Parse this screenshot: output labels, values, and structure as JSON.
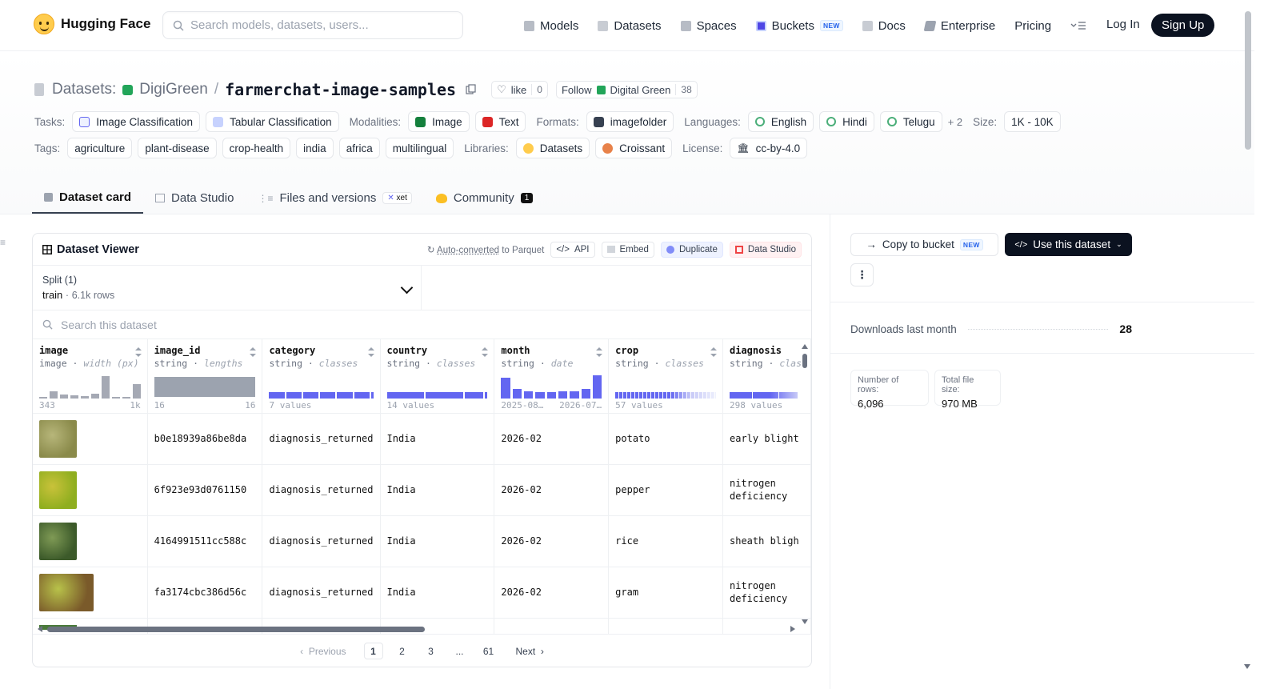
{
  "header": {
    "brand": "Hugging Face",
    "search_placeholder": "Search models, datasets, users...",
    "nav": [
      {
        "label": "Models",
        "icon": "cube-icon",
        "color": "#9ca3af"
      },
      {
        "label": "Datasets",
        "icon": "database-icon",
        "color": "#9ca3af"
      },
      {
        "label": "Spaces",
        "icon": "grid-icon",
        "color": "#9ca3af"
      },
      {
        "label": "Buckets",
        "icon": "bucket-icon",
        "color": "#4f46e5",
        "badge": "NEW"
      },
      {
        "label": "Docs",
        "icon": "book-icon",
        "color": "#9ca3af"
      },
      {
        "label": "Enterprise",
        "icon": "building-icon",
        "color": "#9ca3af"
      },
      {
        "label": "Pricing"
      }
    ],
    "login": "Log In",
    "signup": "Sign Up"
  },
  "repo": {
    "prefix": "Datasets:",
    "org": "DigiGreen",
    "name": "farmerchat-image-samples",
    "like_label": "like",
    "like_count": "0",
    "follow_label": "Follow",
    "follow_org": "Digital Green",
    "follow_count": "38"
  },
  "tags_row1": {
    "tasks_label": "Tasks:",
    "tasks": [
      "Image Classification",
      "Tabular Classification"
    ],
    "modalities_label": "Modalities:",
    "modalities": [
      "Image",
      "Text"
    ],
    "formats_label": "Formats:",
    "formats": [
      "imagefolder"
    ],
    "languages_label": "Languages:",
    "languages": [
      "English",
      "Hindi",
      "Telugu"
    ],
    "languages_more": "+ 2",
    "size_label": "Size:",
    "size": "1K - 10K"
  },
  "tags_row2": {
    "tags_label": "Tags:",
    "tags": [
      "agriculture",
      "plant-disease",
      "crop-health",
      "india",
      "africa",
      "multilingual"
    ],
    "libraries_label": "Libraries:",
    "libraries": [
      "Datasets",
      "Croissant"
    ],
    "license_label": "License:",
    "license": "cc-by-4.0"
  },
  "tabs": [
    {
      "label": "Dataset card",
      "active": true
    },
    {
      "label": "Data Studio"
    },
    {
      "label": "Files and versions",
      "badge": "xet"
    },
    {
      "label": "Community",
      "count": "1"
    }
  ],
  "viewer": {
    "title": "Dataset Viewer",
    "auto_link": "Auto-converted",
    "auto_rest": "to Parquet",
    "api": "API",
    "embed": "Embed",
    "duplicate": "Duplicate",
    "data_studio": "Data Studio",
    "split_label": "Split (1)",
    "split_name": "train",
    "split_rows": "6.1k rows",
    "search_placeholder": "Search this dataset",
    "columns": [
      {
        "name": "image",
        "type": "image",
        "stat": "width (px)",
        "foot_left": "343",
        "foot_right": "1k"
      },
      {
        "name": "image_id",
        "type": "string",
        "stat": "lengths",
        "foot_left": "16",
        "foot_right": "16"
      },
      {
        "name": "category",
        "type": "string",
        "stat": "classes",
        "foot_left": "7 values",
        "foot_right": ""
      },
      {
        "name": "country",
        "type": "string",
        "stat": "classes",
        "foot_left": "14 values",
        "foot_right": ""
      },
      {
        "name": "month",
        "type": "string",
        "stat": "date",
        "foot_left": "2025-08…",
        "foot_right": "2026-07…"
      },
      {
        "name": "crop",
        "type": "string",
        "stat": "classes",
        "foot_left": "57 values",
        "foot_right": ""
      },
      {
        "name": "diagnosis",
        "type": "string",
        "stat": "clas",
        "foot_left": "298 values",
        "foot_right": ""
      }
    ],
    "rows": [
      {
        "image_id": "b0e18939a86be8da",
        "category": "diagnosis_returned",
        "country": "India",
        "month": "2026-02",
        "crop": "potato",
        "diagnosis": "early blight",
        "thumb": [
          "#8a8a4a",
          "#b7b67a"
        ]
      },
      {
        "image_id": "6f923e93d0761150",
        "category": "diagnosis_returned",
        "country": "India",
        "month": "2026-02",
        "crop": "pepper",
        "diagnosis": "nitrogen deficiency",
        "thumb": [
          "#8fae1f",
          "#c9c23a"
        ]
      },
      {
        "image_id": "4164991511cc588c",
        "category": "diagnosis_returned",
        "country": "India",
        "month": "2026-02",
        "crop": "rice",
        "diagnosis": "sheath bligh",
        "thumb": [
          "#3c5a2a",
          "#7f9a55"
        ]
      },
      {
        "image_id": "fa3174cbc386d56c",
        "category": "diagnosis_returned",
        "country": "India",
        "month": "2026-02",
        "crop": "gram",
        "diagnosis": "nitrogen deficiency",
        "thumb": [
          "#7a5a2a",
          "#b8c24a"
        ]
      }
    ],
    "pager": {
      "prev": "Previous",
      "pages": [
        "1",
        "2",
        "3",
        "...",
        "61"
      ],
      "next": "Next"
    }
  },
  "right": {
    "copy": "Copy to bucket",
    "copy_badge": "NEW",
    "use": "Use this dataset",
    "downloads_label": "Downloads last month",
    "downloads": "28",
    "rows_label": "Number of rows:",
    "rows_value": "6,096",
    "size_label": "Total file size:",
    "size_value": "970 MB"
  }
}
